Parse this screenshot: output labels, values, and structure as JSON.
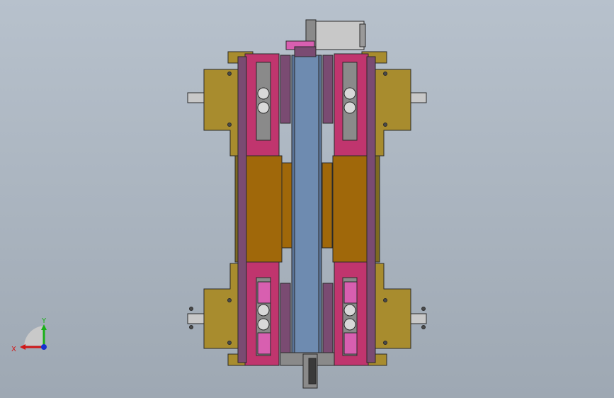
{
  "viewport": {
    "background_top": "#b7c1cc",
    "background_bottom": "#9ea8b3"
  },
  "model": {
    "view": "top-front",
    "colors": {
      "olive": "#a88c2e",
      "olive_dark": "#7e6a22",
      "magenta": "#c0356e",
      "magenta_dark": "#8f2552",
      "purple": "#7a4b72",
      "steel_blue": "#6e8bb0",
      "amber": "#a0680a",
      "gray": "#8a8a8a",
      "pink": "#d85fb0",
      "motor": "#c8c8c8",
      "outline": "#2a2a2a"
    }
  },
  "triad": {
    "x_label": "X",
    "y_label": "Y",
    "x_color": "#d01818",
    "y_color": "#18b018",
    "z_color": "#1830d0"
  }
}
